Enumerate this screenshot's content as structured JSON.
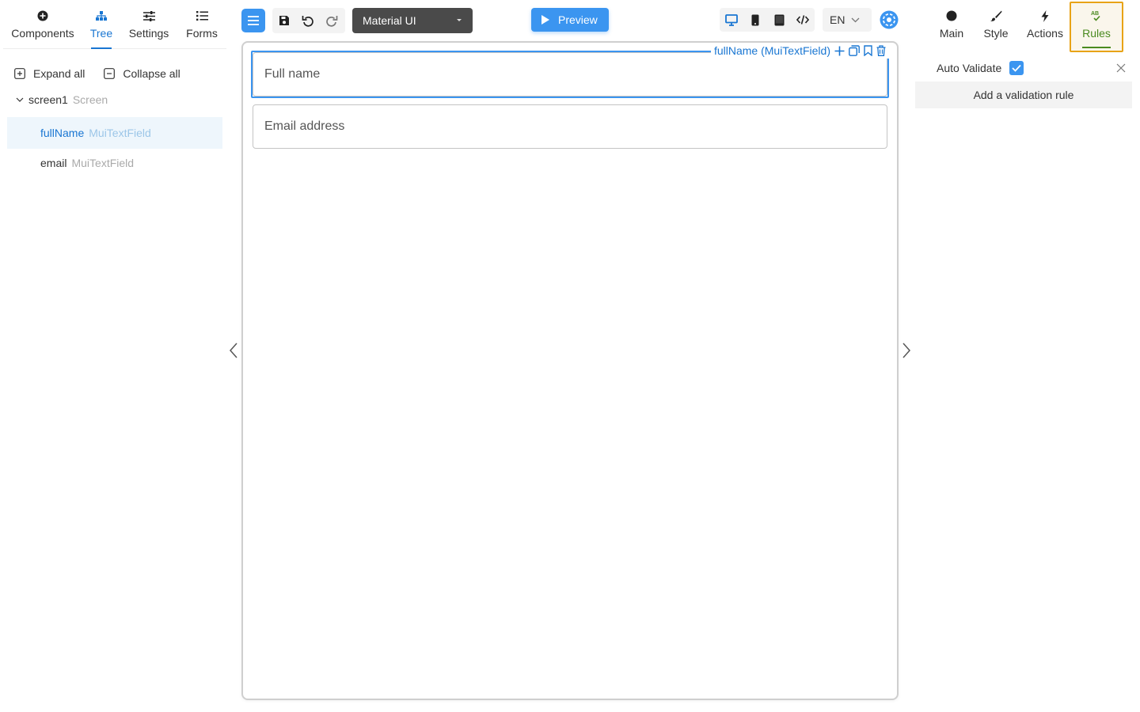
{
  "left_tabs": [
    {
      "label": "Components",
      "icon": "plus-circle-icon"
    },
    {
      "label": "Tree",
      "icon": "tree-icon",
      "active": true
    },
    {
      "label": "Settings",
      "icon": "sliders-icon"
    },
    {
      "label": "Forms",
      "icon": "list-icon"
    }
  ],
  "tree": {
    "expand_all": "Expand all",
    "collapse_all": "Collapse all",
    "root": {
      "name": "screen1",
      "type": "Screen"
    },
    "children": [
      {
        "name": "fullName",
        "type": "MuiTextField",
        "selected": true
      },
      {
        "name": "email",
        "type": "MuiTextField"
      }
    ]
  },
  "toolbar": {
    "library": "Material UI",
    "preview": "Preview",
    "language": "EN"
  },
  "canvas": {
    "selected_label": "fullName (MuiTextField)",
    "fields": [
      {
        "placeholder": "Full name"
      },
      {
        "placeholder": "Email address"
      }
    ]
  },
  "right_tabs": [
    {
      "label": "Main",
      "icon": "circle-icon"
    },
    {
      "label": "Style",
      "icon": "brush-icon"
    },
    {
      "label": "Actions",
      "icon": "lightning-icon"
    },
    {
      "label": "Rules",
      "icon": "ab-check-icon",
      "active": true
    }
  ],
  "rules_panel": {
    "auto_validate_label": "Auto Validate",
    "auto_validate_checked": true,
    "add_rule": "Add a validation rule"
  },
  "colors": {
    "accent": "#3b95f0",
    "active_text": "#1976d2",
    "rules_highlight": "#e8a317",
    "rules_active": "#4a8a1f"
  }
}
